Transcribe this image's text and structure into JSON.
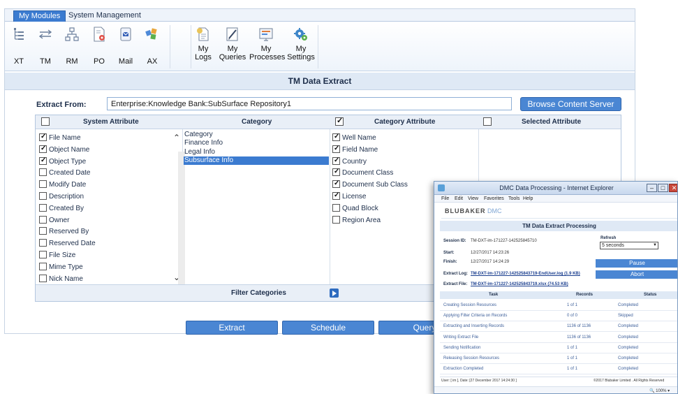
{
  "tabs": [
    {
      "label": "My Modules",
      "active": true
    },
    {
      "label": "System Management",
      "active": false
    }
  ],
  "ribbon": {
    "buttons": [
      {
        "label": "XT",
        "icon": "tree-list-icon"
      },
      {
        "label": "TM",
        "icon": "transfer-arrows-icon"
      },
      {
        "label": "RM",
        "icon": "org-chart-icon"
      },
      {
        "label": "PO",
        "icon": "document-gear-icon"
      },
      {
        "label": "Mail",
        "icon": "mail-icon"
      },
      {
        "label": "AX",
        "icon": "puzzle-icon"
      }
    ],
    "my_buttons": [
      {
        "line1": "My",
        "line2": "Logs",
        "icon": "log-document-icon"
      },
      {
        "line1": "My",
        "line2": "Queries",
        "icon": "query-pen-icon"
      },
      {
        "line1": "My",
        "line2": "Processes",
        "icon": "process-screen-icon"
      },
      {
        "line1": "My",
        "line2": "Settings",
        "icon": "settings-gear-icon"
      }
    ]
  },
  "page_title": "TM Data Extract",
  "extract": {
    "label": "Extract From:",
    "value": "Enterprise:Knowledge Bank:SubSurface Repository1",
    "browse_label": "Browse Content Server"
  },
  "columns": {
    "system_attribute": "System Attribute",
    "category": "Category",
    "category_attribute": "Category Attribute",
    "selected_attribute": "Selected Attribute"
  },
  "header_checks": {
    "system_attribute": false,
    "category_attribute": true,
    "selected_attribute": false
  },
  "system_attributes": [
    {
      "label": "File Name",
      "checked": true
    },
    {
      "label": "Object Name",
      "checked": true
    },
    {
      "label": "Object Type",
      "checked": true
    },
    {
      "label": "Created Date",
      "checked": false
    },
    {
      "label": "Modify Date",
      "checked": false
    },
    {
      "label": "Description",
      "checked": false
    },
    {
      "label": "Created By",
      "checked": false
    },
    {
      "label": "Owner",
      "checked": false
    },
    {
      "label": "Reserved By",
      "checked": false
    },
    {
      "label": "Reserved Date",
      "checked": false
    },
    {
      "label": "File Size",
      "checked": false
    },
    {
      "label": "Mime Type",
      "checked": false
    },
    {
      "label": "Nick Name",
      "checked": false
    }
  ],
  "categories": [
    {
      "label": "Category",
      "selected": false
    },
    {
      "label": "Finance Info",
      "selected": false
    },
    {
      "label": "Legal Info",
      "selected": false
    },
    {
      "label": "Subsurface Info",
      "selected": true
    }
  ],
  "category_attributes": [
    {
      "label": "Well Name",
      "checked": true
    },
    {
      "label": "Field Name",
      "checked": true
    },
    {
      "label": "Country",
      "checked": true
    },
    {
      "label": "Document Class",
      "checked": true
    },
    {
      "label": "Document Sub Class",
      "checked": true
    },
    {
      "label": "License",
      "checked": true
    },
    {
      "label": "Quad Block",
      "checked": false
    },
    {
      "label": "Region Area",
      "checked": false
    }
  ],
  "filter_label": "Filter Categories",
  "actions": {
    "extract": "Extract",
    "schedule": "Schedule",
    "query": "Query"
  },
  "popup": {
    "title": "DMC Data Processing - Internet Explorer",
    "menu": [
      "File",
      "Edit",
      "View",
      "Favorites",
      "Tools",
      "Help"
    ],
    "brand": "BLUBAKER",
    "brand_sub": "DMC",
    "heading": "TM Data Extract Processing",
    "session_label": "Session ID:",
    "session_id": "TM-DXT-im-171227-142525845710",
    "start_label": "Start:",
    "start": "12/27/2017 14:23:26",
    "finish_label": "Finish:",
    "finish": "12/27/2017 14:24:29",
    "extract_log_label": "Extract Log:",
    "extract_log": "TM-DXT-im-171227-142525843719-EndUser.log (1.9 KB)",
    "extract_file_label": "Extract File:",
    "extract_file": "TM-DXT-im-171227-142525843719.xlsx (74.53 KB)",
    "refresh_label": "Refresh",
    "refresh_value": "5 seconds",
    "pause": "Pause",
    "abort": "Abort",
    "table_headers": [
      "Task",
      "Records",
      "Status"
    ],
    "rows": [
      {
        "task": "Creating Session Resources",
        "records": "1 of 1",
        "status": "Completed"
      },
      {
        "task": "Applying Filter Criteria on Records",
        "records": "0 of 0",
        "status": "Skipped"
      },
      {
        "task": "Extracting and Inserting Records",
        "records": "1136 of 1136",
        "status": "Completed"
      },
      {
        "task": "Writing Extract File",
        "records": "1136 of 1136",
        "status": "Completed"
      },
      {
        "task": "Sending Notification",
        "records": "1 of 1",
        "status": "Completed"
      },
      {
        "task": "Releasing Session Resources",
        "records": "1 of 1",
        "status": "Completed"
      },
      {
        "task": "Extraction Completed",
        "records": "1 of 1",
        "status": "Completed"
      }
    ],
    "footer_user": "User: [ im ], Date: [27 December 2017 14:24:30 ]",
    "footer_copy": "©2017 Blubaker Limited . All Rights Reserved",
    "zoom": "100%"
  }
}
